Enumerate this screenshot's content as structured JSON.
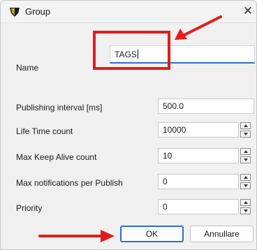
{
  "window": {
    "title": "Group",
    "close_glyph": "✕",
    "app_icon": "shield-icon"
  },
  "form": {
    "name_label": "Name",
    "name_value": "TAGS",
    "publishing_interval_label": "Publishing interval [ms]",
    "publishing_interval_value": "500.0",
    "life_time_label": "Life Time count",
    "life_time_value": "10000",
    "max_keep_alive_label": "Max Keep Alive count",
    "max_keep_alive_value": "10",
    "max_notifications_label": "Max notifications per Publish",
    "max_notifications_value": "0",
    "priority_label": "Priority",
    "priority_value": "0"
  },
  "buttons": {
    "ok_label": "OK",
    "cancel_label": "Annullare"
  },
  "annotations": {
    "highlight_color": "#e41b1b"
  }
}
